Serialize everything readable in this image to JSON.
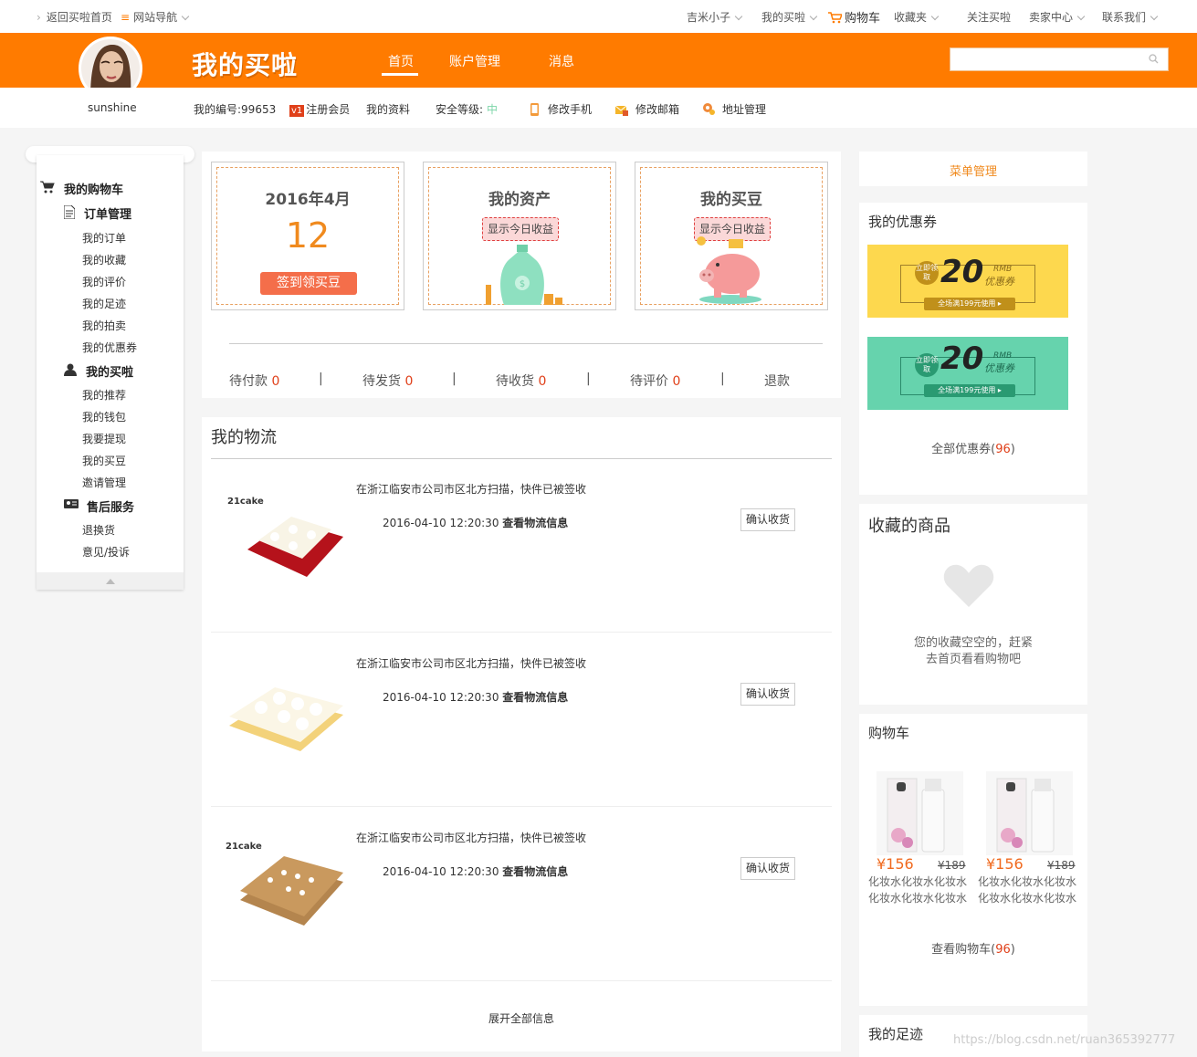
{
  "topbar": {
    "back_home": "返回买啦首页",
    "site_nav": "网站导航",
    "user": "吉米小子",
    "my_maila": "我的买啦",
    "cart": "购物车",
    "favorites": "收藏夹",
    "follow": "关注买啦",
    "seller_center": "卖家中心",
    "contact": "联系我们"
  },
  "header": {
    "logo": "我的买啦",
    "nav": [
      "首页",
      "账户管理",
      "消息"
    ],
    "search_placeholder": ""
  },
  "profile": {
    "username": "sunshine",
    "user_id": "我的编号:99653",
    "member": "注册会员",
    "member_badge": "v1",
    "profile_link": "我的资料",
    "security_label": "安全等级:",
    "security_level": "中",
    "phone": "修改手机",
    "email": "修改邮箱",
    "address": "地址管理"
  },
  "sidebar": {
    "sections": [
      {
        "title": "我的购物车",
        "items": []
      },
      {
        "title": "订单管理",
        "items": [
          "我的订单",
          "我的收藏",
          "我的评价",
          "我的足迹",
          "我的拍卖",
          "我的优惠券"
        ]
      },
      {
        "title": "我的买啦",
        "items": [
          "我的推荐",
          "我的钱包",
          "我要提现",
          "我的买豆",
          "邀请管理"
        ]
      },
      {
        "title": "售后服务",
        "items": [
          "退换货",
          "意见/投诉"
        ]
      }
    ]
  },
  "summary": {
    "date": "2016年4月",
    "day": "12",
    "sign_btn": "签到领买豆",
    "assets_title": "我的资产",
    "assets_tag": "显示今日收益",
    "beans_title": "我的买豆",
    "beans_tag": "显示今日收益"
  },
  "order_status": [
    {
      "label": "待付款",
      "count": "0"
    },
    {
      "label": "待发货",
      "count": "0"
    },
    {
      "label": "待收货",
      "count": "0"
    },
    {
      "label": "待评价",
      "count": "0"
    },
    {
      "label": "退款",
      "count": ""
    }
  ],
  "logistics": {
    "title": "我的物流",
    "rows": [
      {
        "msg": "在浙江临安市公司市区北方扫描，快件已被签收",
        "date": "2016-04-10 12:20:30",
        "link": "查看物流信息",
        "btn": "确认收货",
        "brand": "21cake"
      },
      {
        "msg": "在浙江临安市公司市区北方扫描，快件已被签收",
        "date": "2016-04-10 12:20:30",
        "link": "查看物流信息",
        "btn": "确认收货",
        "brand": ""
      },
      {
        "msg": "在浙江临安市公司市区北方扫描，快件已被签收",
        "date": "2016-04-10 12:20:30",
        "link": "查看物流信息",
        "btn": "确认收货",
        "brand": "21cake"
      }
    ],
    "expand": "展开全部信息"
  },
  "right": {
    "menu_mgmt": "菜单管理",
    "coupons_title": "我的优惠券",
    "coupons": [
      {
        "action": "立即领取",
        "amount": "20",
        "rmb": "RMB",
        "type": "优惠券",
        "cond": "全场满199元使用",
        "color": "#fdd84e"
      },
      {
        "action": "立即领取",
        "amount": "20",
        "rmb": "RMB",
        "type": "优惠券",
        "cond": "全场满199元使用",
        "color": "#66d3ad"
      }
    ],
    "all_coupons": "全部优惠券",
    "all_coupons_count": "96",
    "fav_title": "收藏的商品",
    "fav_empty_1": "您的收藏空空的，赶紧",
    "fav_empty_2": "去首页看看购物吧",
    "cart_title": "购物车",
    "cart_items": [
      {
        "price": "¥156",
        "old": "¥189",
        "name": "化妆水化妆水化妆水化妆水化妆水化妆水"
      },
      {
        "price": "¥156",
        "old": "¥189",
        "name": "化妆水化妆水化妆水化妆水化妆水化妆水"
      }
    ],
    "view_cart": "查看购物车",
    "view_cart_count": "96",
    "footprint_title": "我的足迹"
  },
  "watermark": "https://blog.csdn.net/ruan365392777",
  "colors": {
    "brand": "#ff7b00",
    "accent_red": "#e0401a",
    "coupon_yellow": "#fdd84e",
    "coupon_green": "#66d3ad"
  }
}
